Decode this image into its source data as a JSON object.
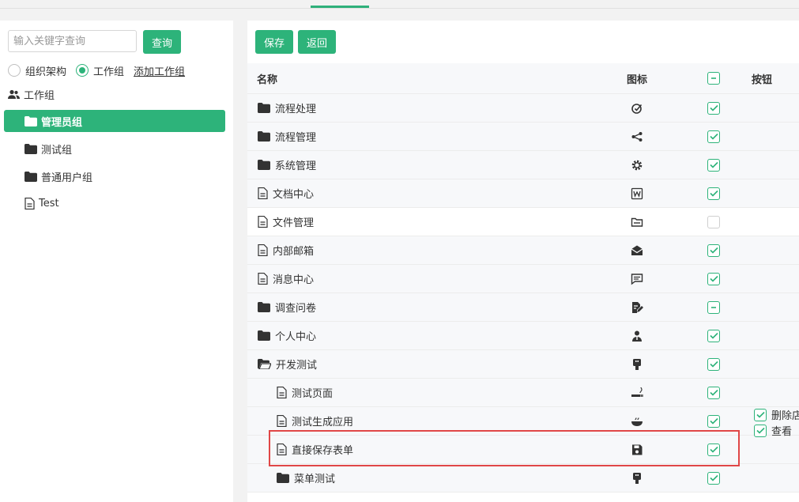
{
  "search": {
    "placeholder": "输入关键字查询",
    "button_label": "查询"
  },
  "radio": {
    "option_org": "组织架构",
    "option_workgroup": "工作组",
    "add_link": "添加工作组"
  },
  "group_header": "工作组",
  "groups": [
    {
      "label": "管理员组",
      "selected": true
    },
    {
      "label": "测试组"
    },
    {
      "label": "普通用户组"
    },
    {
      "label": "Test"
    }
  ],
  "toolbar": {
    "save_label": "保存",
    "back_label": "返回"
  },
  "table": {
    "col_name": "名称",
    "col_icon": "图标",
    "col_button": "按钮",
    "rows": [
      {
        "name": "流程处理",
        "type": "folder",
        "icon": "check-edit-icon",
        "state": "checked"
      },
      {
        "name": "流程管理",
        "type": "folder",
        "icon": "share-nodes-icon",
        "state": "checked"
      },
      {
        "name": "系统管理",
        "type": "folder",
        "icon": "gear-icon",
        "state": "checked"
      },
      {
        "name": "文档中心",
        "type": "file",
        "icon": "word-doc-icon",
        "state": "checked"
      },
      {
        "name": "文件管理",
        "type": "file",
        "icon": "folder-outline-icon",
        "state": "unchecked"
      },
      {
        "name": "内部邮箱",
        "type": "file",
        "icon": "mail-open-icon",
        "state": "checked"
      },
      {
        "name": "消息中心",
        "type": "file",
        "icon": "message-icon",
        "state": "checked"
      },
      {
        "name": "调查问卷",
        "type": "folder",
        "icon": "document-edit-icon",
        "state": "indeterminate"
      },
      {
        "name": "个人中心",
        "type": "folder",
        "icon": "person-icon",
        "state": "checked"
      },
      {
        "name": "开发测试",
        "type": "folder-open",
        "icon": "usb-icon",
        "state": "checked"
      },
      {
        "name": "测试页面",
        "type": "file",
        "icon": "smoking-icon",
        "state": "checked"
      },
      {
        "name": "测试生成应用",
        "type": "file",
        "icon": "bowl-icon",
        "state": "checked"
      },
      {
        "name": "直接保存表单",
        "type": "file",
        "icon": "floppy-icon",
        "state": "checked"
      },
      {
        "name": "菜单测试",
        "type": "folder",
        "icon": "usb-icon",
        "state": "checked"
      }
    ]
  },
  "button_perms": [
    "删除店",
    "查看"
  ],
  "colors": {
    "accent": "#2db37a",
    "highlight": "#e04747"
  }
}
